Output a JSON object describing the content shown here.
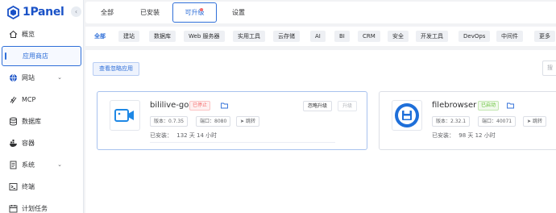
{
  "app": {
    "logo_text": "1Panel"
  },
  "sidebar": {
    "items": [
      {
        "label": "概览",
        "icon": "home-icon"
      },
      {
        "label": "应用商店",
        "icon": "app-store-icon",
        "active": true
      },
      {
        "label": "网站",
        "icon": "globe-icon",
        "expandable": true
      },
      {
        "label": "MCP",
        "icon": "mcp-icon"
      },
      {
        "label": "数据库",
        "icon": "database-icon"
      },
      {
        "label": "容器",
        "icon": "container-icon"
      },
      {
        "label": "系统",
        "icon": "system-icon",
        "expandable": true
      },
      {
        "label": "终端",
        "icon": "terminal-icon"
      },
      {
        "label": "计划任务",
        "icon": "cron-icon"
      }
    ]
  },
  "tabs": [
    {
      "label": "全部"
    },
    {
      "label": "已安装"
    },
    {
      "label": "可升级",
      "active": true,
      "dot": true
    },
    {
      "label": "设置"
    }
  ],
  "categories": [
    "全部",
    "建站",
    "数据库",
    "Web 服务器",
    "实用工具",
    "云存储",
    "AI",
    "BI",
    "CRM",
    "安全",
    "开发工具",
    "DevOps",
    "中间件",
    "更多"
  ],
  "main": {
    "ignored_button": "查看忽略应用",
    "search_placeholder": "搜"
  },
  "apps": [
    {
      "name": "bililive-go",
      "status": "已停止",
      "version_label": "版本：0.7.35",
      "port_label": "端口：8080",
      "jump_label": "跳转",
      "installed_label": "已安装：",
      "installed_value": "132 天 14 小时",
      "ignore_upgrade": "忽略升级",
      "upgrade": "升级"
    },
    {
      "name": "filebrowser",
      "status": "已启动",
      "version_label": "版本：2.32.1",
      "port_label": "端口：40071",
      "jump_label": "跳转",
      "installed_label": "已安装：",
      "installed_value": "98 天 12 小时"
    }
  ],
  "colors": {
    "accent": "#2f6fd8",
    "stopped": "#f56c6c",
    "running": "#67c23a"
  }
}
